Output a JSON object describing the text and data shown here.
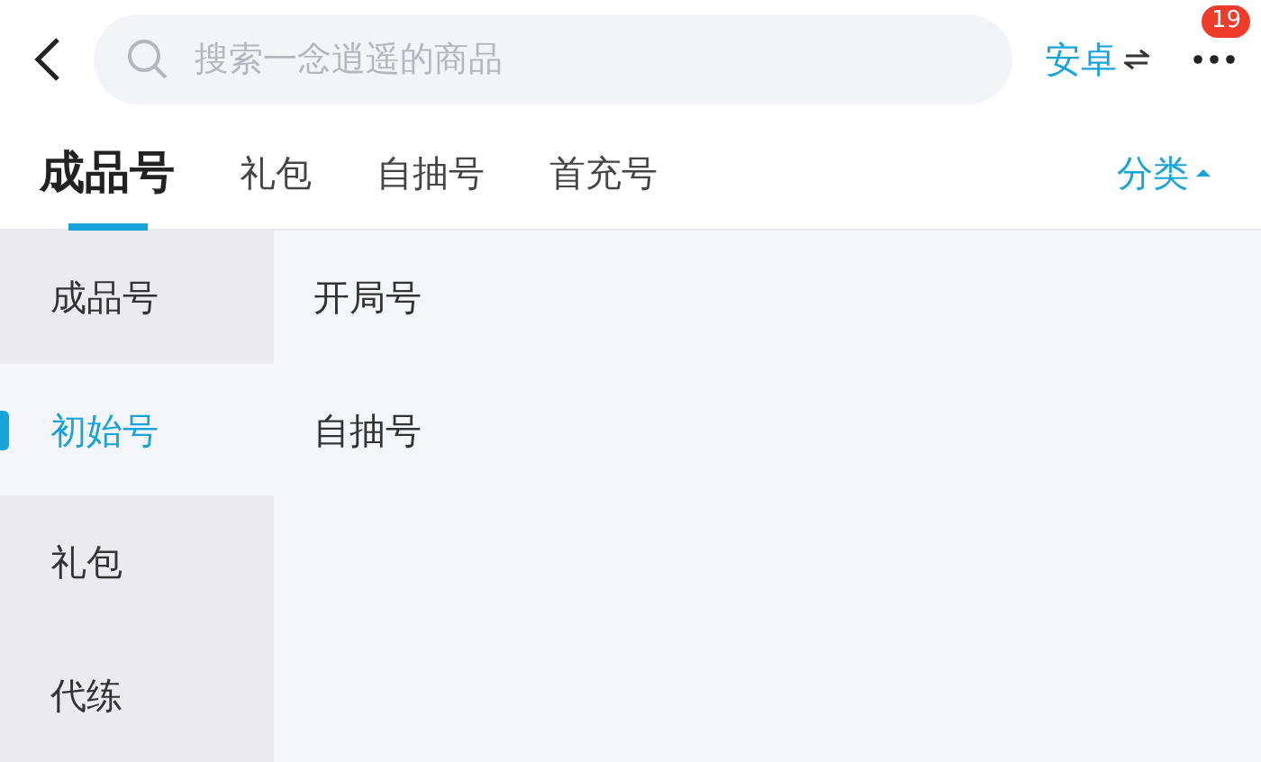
{
  "search": {
    "placeholder": "搜索一念逍遥的商品"
  },
  "platform": {
    "label": "安卓"
  },
  "more": {
    "badge": "19"
  },
  "tabs": [
    {
      "label": "成品号",
      "selected": true
    },
    {
      "label": "礼包",
      "selected": false
    },
    {
      "label": "自抽号",
      "selected": false
    },
    {
      "label": "首充号",
      "selected": false
    }
  ],
  "category": {
    "label": "分类",
    "expanded": true
  },
  "sidebar": {
    "items": [
      {
        "label": "成品号",
        "selected": false
      },
      {
        "label": "初始号",
        "selected": true
      },
      {
        "label": "礼包",
        "selected": false
      },
      {
        "label": "代练",
        "selected": false
      }
    ]
  },
  "options": [
    "开局号",
    "自抽号"
  ]
}
